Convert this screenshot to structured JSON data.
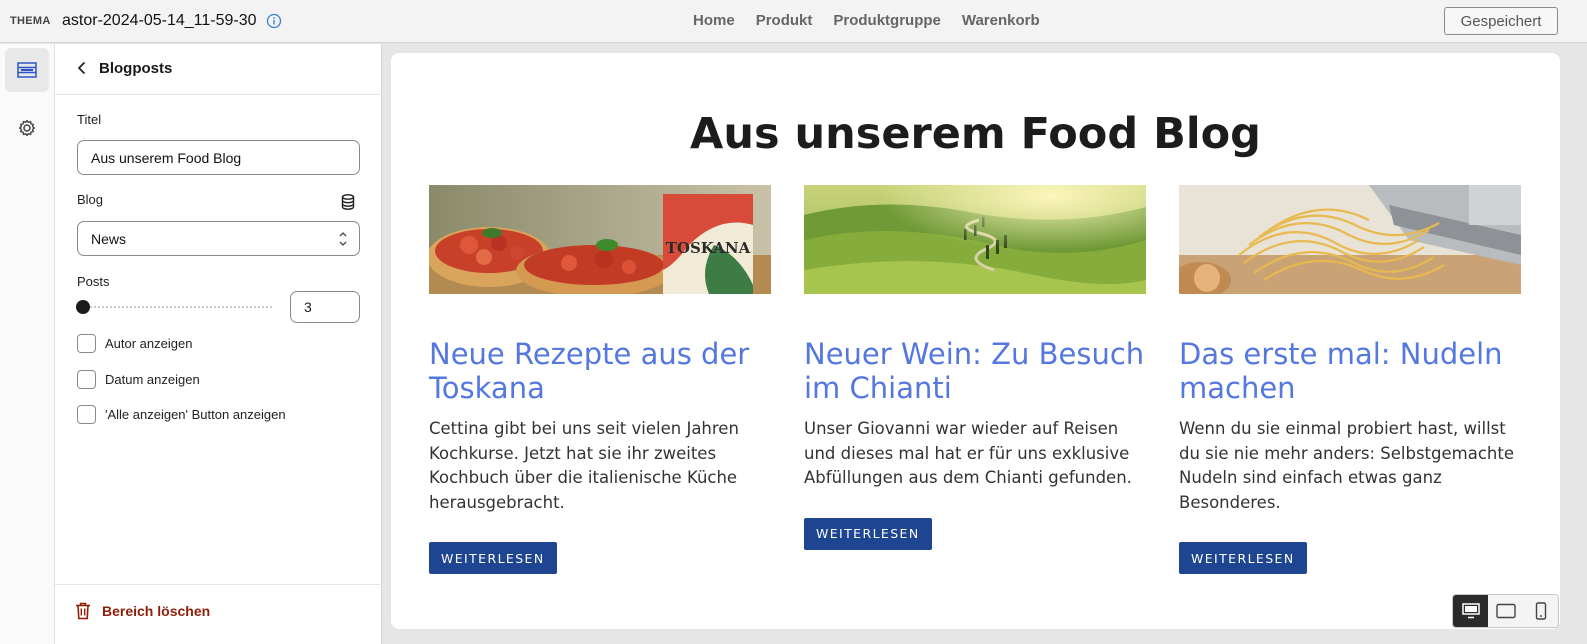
{
  "topbar": {
    "thema_label": "THEMA",
    "theme_name": "astor-2024-05-14_11-59-30",
    "nav": [
      "Home",
      "Produkt",
      "Produktgruppe",
      "Warenkorb"
    ],
    "saved_label": "Gespeichert"
  },
  "rail": {
    "items": [
      {
        "icon": "sections-icon",
        "active": true
      },
      {
        "icon": "gear-icon",
        "active": false
      }
    ]
  },
  "panel": {
    "title": "Blogposts",
    "titel_label": "Titel",
    "titel_value": "Aus unserem Food Blog",
    "blog_label": "Blog",
    "blog_value": "News",
    "posts_label": "Posts",
    "posts_value": "3",
    "posts_slider_fraction": 0,
    "checkboxes": [
      {
        "label": "Autor anzeigen",
        "checked": false
      },
      {
        "label": "Datum anzeigen",
        "checked": false
      },
      {
        "label": "'Alle anzeigen' Button anzeigen",
        "checked": false
      }
    ],
    "delete_label": "Bereich löschen"
  },
  "preview": {
    "heading": "Aus unserem Food Blog",
    "cards": [
      {
        "title": "Neue Rezepte aus der Toskana",
        "text": "Cettina gibt bei uns seit vielen Jahren Kochkurse. Jetzt hat sie ihr zweites Kochbuch über die italienische Küche herausgebracht.",
        "button": "WEITERLESEN",
        "book_text": "TOSKANA"
      },
      {
        "title": "Neuer Wein: Zu Besuch im Chianti",
        "text": "Unser Giovanni war wieder auf Reisen und dieses mal hat er für uns exklusive Abfüllungen aus dem Chianti gefunden.",
        "button": "WEITERLESEN"
      },
      {
        "title": "Das erste mal: Nudeln machen",
        "text": "Wenn du sie einmal probiert hast, willst du sie nie mehr anders: Selbstgemachte Nudeln sind einfach etwas ganz Besonderes.",
        "button": "WEITERLESEN"
      }
    ]
  },
  "device_toggle": {
    "items": [
      "desktop-icon",
      "tablet-icon",
      "mobile-icon"
    ],
    "active": "desktop-icon"
  },
  "colors": {
    "accent_title": "#5477e0",
    "button_bg": "#1e4591",
    "delete": "#8e1f0b"
  }
}
